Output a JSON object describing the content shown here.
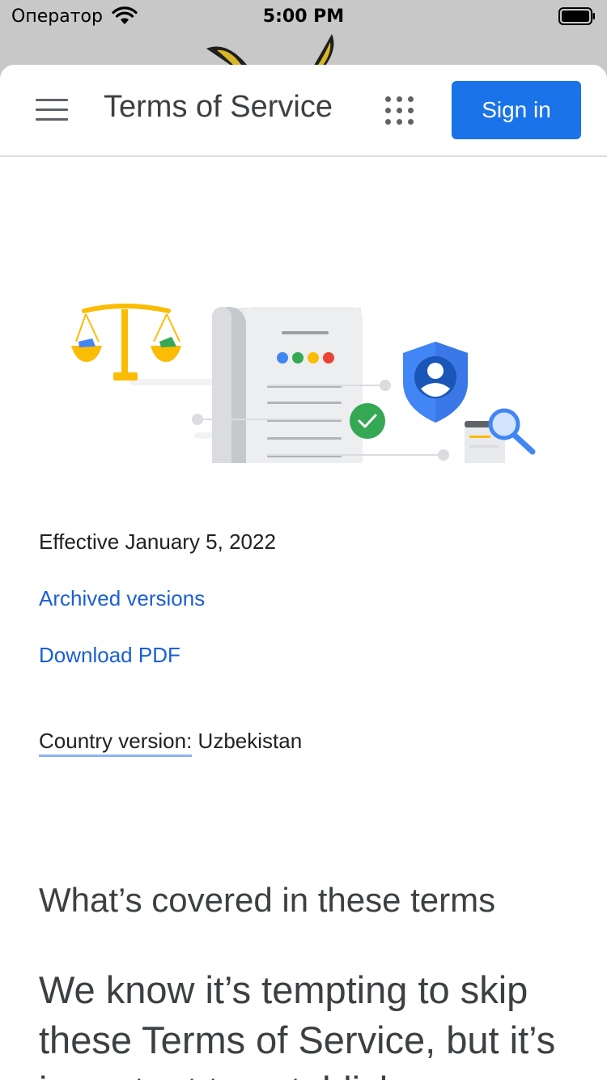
{
  "status_bar": {
    "carrier": "Оператор",
    "time": "5:00 PM"
  },
  "header": {
    "title": "Terms of Service",
    "menu_icon": "hamburger-menu-icon",
    "apps_icon": "apps-grid-icon",
    "sign_in_label": "Sign in"
  },
  "colors": {
    "accent": "#1a73e8",
    "link": "#1a5fd6",
    "text": "#202124",
    "heading": "#3c4043",
    "google_blue": "#4285f4",
    "google_red": "#ea4335",
    "google_yellow": "#fbbc04",
    "google_green": "#34a853"
  },
  "content": {
    "effective": "Effective January 5, 2022",
    "archived_link": "Archived versions",
    "download_link": "Download PDF",
    "country_label": "Country version:",
    "country_value": "Uzbekistan",
    "section_heading": "What’s covered in these terms",
    "intro_text": "We know it’s tempting to skip these Terms of Service, but it’s important to establish"
  }
}
